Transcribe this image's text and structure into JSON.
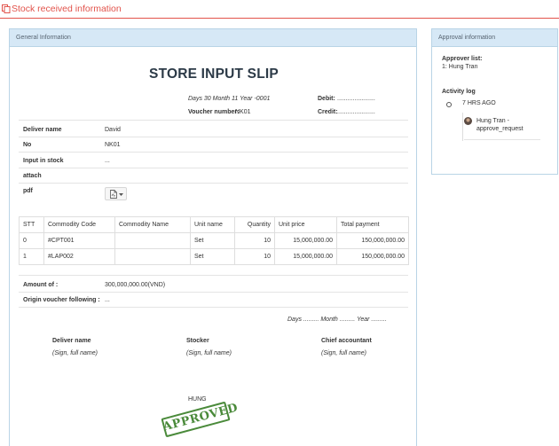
{
  "header": {
    "title": "Stock received information"
  },
  "general": {
    "panel_title": "General Information",
    "slip_title": "STORE INPUT SLIP",
    "date_line": "Days 30 Month 11 Year -0001",
    "debit_label": "Debit:",
    "debit_value": "......................",
    "voucher_label": "Voucher number:",
    "voucher_value": "NK01",
    "credit_label": "Credit:",
    "credit_value": "......................",
    "fields": [
      {
        "label": "Deliver name",
        "value": "David"
      },
      {
        "label": "No",
        "value": "NK01"
      },
      {
        "label": "Input in stock",
        "value": "..."
      },
      {
        "label": "attach",
        "value": ""
      },
      {
        "label": "pdf",
        "value": ""
      }
    ],
    "table": {
      "columns": [
        "STT",
        "Commodity Code",
        "Commodity Name",
        "Unit name",
        "Quantity",
        "Unit price",
        "Total payment"
      ],
      "rows": [
        [
          "0",
          "#CPT001",
          "",
          "Set",
          "10",
          "15,000,000.00",
          "150,000,000.00"
        ],
        [
          "1",
          "#LAP002",
          "",
          "Set",
          "10",
          "15,000,000.00",
          "150,000,000.00"
        ]
      ]
    },
    "amount_label": "Amount of :",
    "amount_value": "300,000,000.00(VND)",
    "origin_label": "Origin voucher following :",
    "origin_value": "...",
    "sign_date": "Days ......... Month ......... Year .........",
    "signers": [
      {
        "title": "Deliver name",
        "note": "(Sign, full name)"
      },
      {
        "title": "Stocker",
        "note": "(Sign, full name)"
      },
      {
        "title": "Chief accountant",
        "note": "(Sign, full name)"
      }
    ],
    "signer_name": "HUNG",
    "stamp_text": "APPROVED",
    "stamp_color": "#4a8a3a"
  },
  "approval": {
    "panel_title": "Approval information",
    "approver_list_label": "Approver list:",
    "approver_entry": "1: Hung Tran",
    "activity_label": "Activity log",
    "activity_time": "7 HRS AGO",
    "activity_user": "Hung Tran -",
    "activity_action": "approve_request"
  },
  "icons": {
    "header": "copy-icon",
    "pdf": "pdf-file-icon",
    "caret": "caret-down-icon"
  },
  "colors": {
    "accent": "#e2534b",
    "panel_header": "#d6e8f6",
    "panel_border": "#b9d4e6"
  }
}
